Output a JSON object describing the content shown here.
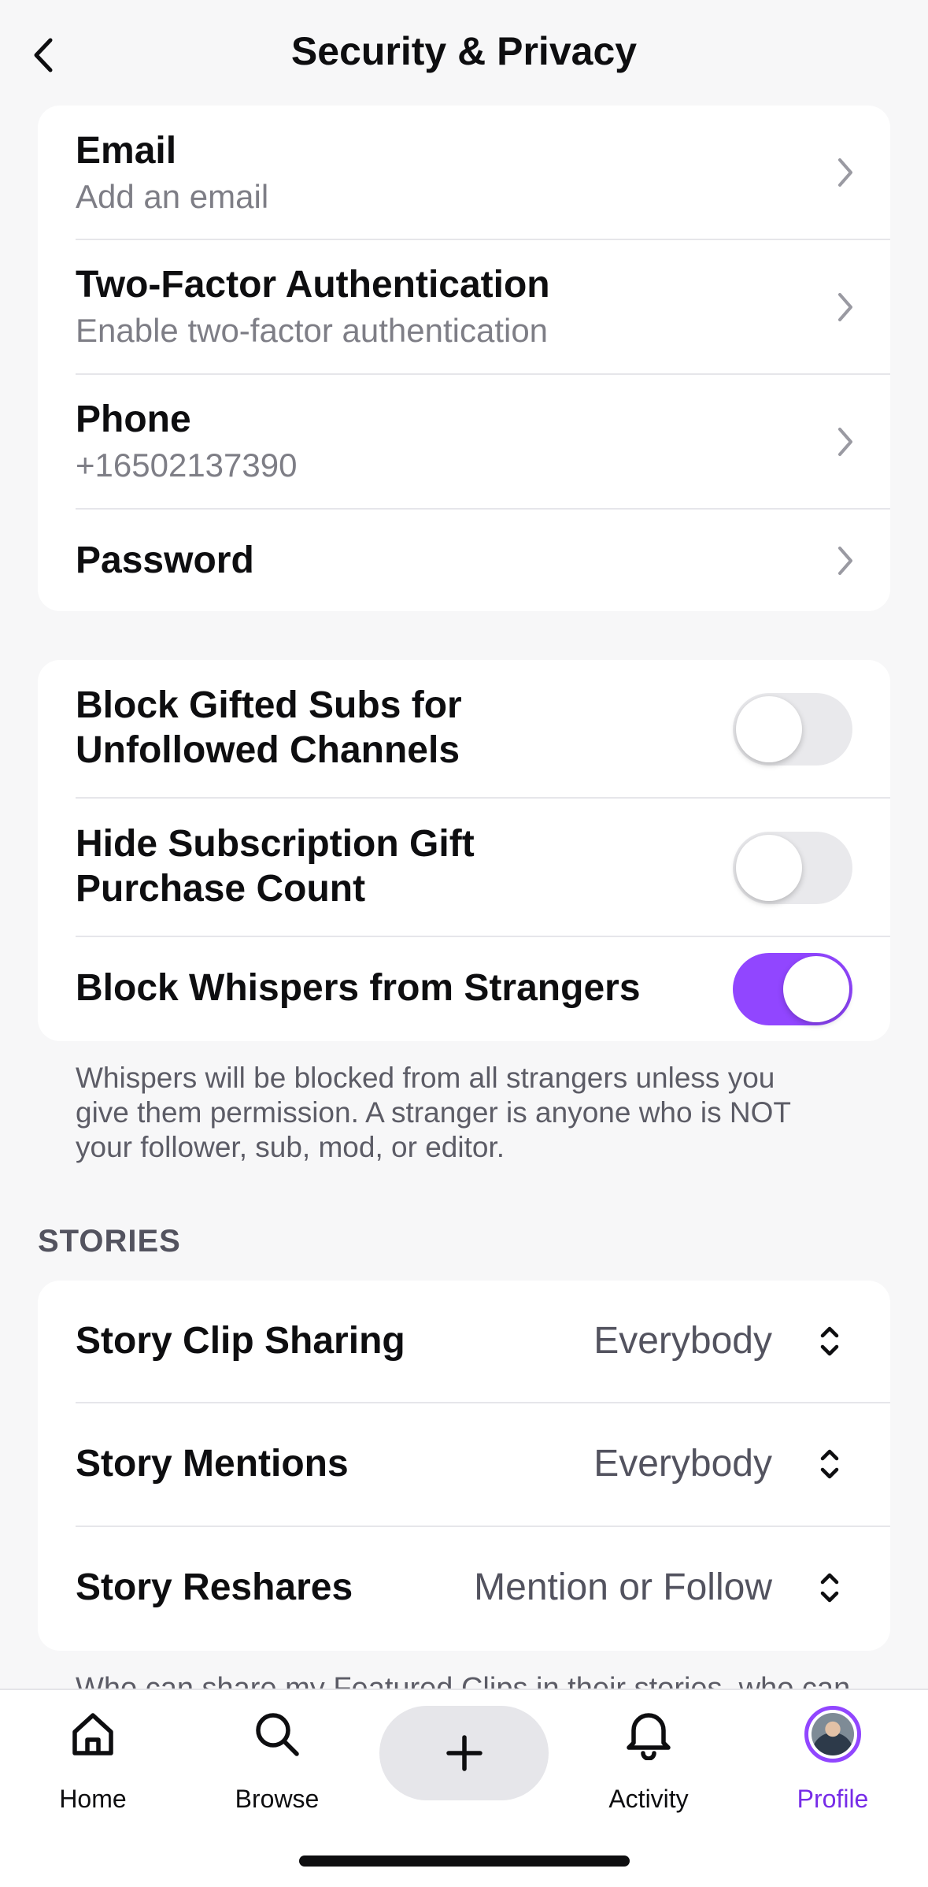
{
  "header": {
    "title": "Security & Privacy"
  },
  "account_card": {
    "rows": [
      {
        "title": "Email",
        "subtitle": "Add an email"
      },
      {
        "title": "Two-Factor Authentication",
        "subtitle": "Enable two-factor authentication"
      },
      {
        "title": "Phone",
        "subtitle": "+16502137390"
      },
      {
        "title": "Password"
      }
    ]
  },
  "privacy_card": {
    "rows": [
      {
        "line1": "Block Gifted Subs for",
        "line2": "Unfollowed Channels",
        "enabled": false
      },
      {
        "line1": "Hide Subscription Gift",
        "line2": "Purchase Count",
        "enabled": false
      },
      {
        "line1": "Block Whispers from Strangers",
        "enabled": true
      }
    ],
    "note_lines": [
      "Whispers will be blocked from all strangers unless you",
      "give them permission. A stranger is anyone who is NOT",
      "your follower, sub, mod, or editor."
    ]
  },
  "stories": {
    "section_label": "STORIES",
    "rows": [
      {
        "title": "Story Clip Sharing",
        "value": "Everybody"
      },
      {
        "title": "Story Mentions",
        "value": "Everybody"
      },
      {
        "title": "Story Reshares",
        "value": "Mention or Follow"
      }
    ],
    "note_partial": "Who can share my Featured Clips in their stories, who can"
  },
  "tabbar": {
    "tabs": [
      {
        "label": "Home",
        "icon": "home-icon"
      },
      {
        "label": "Browse",
        "icon": "search-icon"
      },
      {
        "label": "Activity",
        "icon": "bell-icon"
      },
      {
        "label": "Profile",
        "icon": "avatar",
        "active": true
      }
    ],
    "create_icon": "plus-icon"
  },
  "colors": {
    "accent": "#9146ff",
    "accent_text": "#772ce8",
    "background": "#f7f7f8"
  }
}
